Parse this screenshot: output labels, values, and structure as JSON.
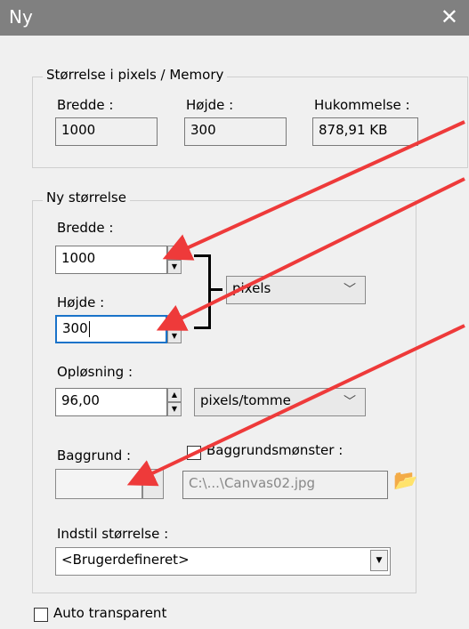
{
  "window": {
    "title": "Ny",
    "close_glyph": "✕"
  },
  "memory_group": {
    "legend": "Størrelse i pixels / Memory",
    "width_label": "Bredde :",
    "width_value": "1000",
    "height_label": "Højde :",
    "height_value": "300",
    "memory_label": "Hukommelse :",
    "memory_value": "878,91 KB"
  },
  "new_size_group": {
    "legend": "Ny størrelse",
    "width_label": "Bredde :",
    "width_value": "1000",
    "height_label": "Højde :",
    "height_value": "300",
    "unit_selected": "pixels",
    "resolution_label": "Opløsning :",
    "resolution_value": "96,00",
    "resolution_unit": "pixels/tomme",
    "background_label": "Baggrund :",
    "pattern_label": "Baggrundsmønster :",
    "pattern_checked": false,
    "pattern_path": "C:\\...\\Canvas02.jpg",
    "preset_label": "Indstil størrelse :",
    "preset_value": "<Brugerdefineret>"
  },
  "auto_transparent_label": "Auto transparent",
  "auto_transparent_checked": false,
  "colors": {
    "annotation_arrow": "#ee3a3a",
    "focus_border": "#1a73c9",
    "titlebar": "#808080"
  },
  "icons": [
    "close-icon",
    "spin-up-icon",
    "spin-down-icon",
    "chevron-down-icon",
    "dropdown-arrow-icon",
    "folder-open-icon",
    "checkbox-icon"
  ]
}
